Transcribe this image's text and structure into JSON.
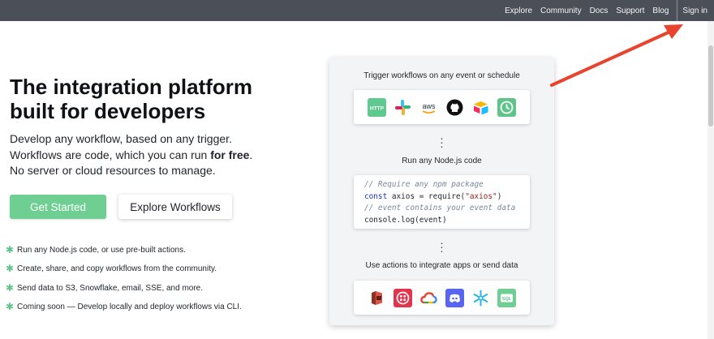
{
  "nav": {
    "links": [
      "Explore",
      "Community",
      "Docs",
      "Support",
      "Blog"
    ],
    "signin": "Sign in"
  },
  "hero": {
    "title": "The integration platform built for developers",
    "sub_line1": "Develop any workflow, based on any trigger.",
    "sub_line2_pre": "Workflows are code, which you can run ",
    "sub_line2_bold": "for free",
    "sub_line2_post": ".",
    "sub_line3": "No server or cloud resources to manage.",
    "primary_button": "Get Started",
    "secondary_button": "Explore Workflows"
  },
  "features": [
    "Run any Node.js code, or use pre-built actions.",
    "Create, share, and copy workflows from the community.",
    "Send data to S3, Snowflake, email, SSE, and more.",
    "Coming soon — Develop locally and deploy workflows via CLI."
  ],
  "panel": {
    "trigger_title": "Trigger workflows on any event or schedule",
    "trigger_icons": [
      "http-icon",
      "slack-icon",
      "aws-icon",
      "github-icon",
      "airtable-icon",
      "clock-icon"
    ],
    "http_label": "HTTP",
    "aws_label": "aws",
    "node_title": "Run any Node.js code",
    "code": {
      "line1": "// Require any npm package",
      "line2_kw": "const",
      "line2_mid": " axios = require(",
      "line2_str": "\"axios\"",
      "line2_end": ")",
      "line3": "// event contains your event data",
      "line4": "console.log(event)"
    },
    "actions_title": "Use actions to integrate apps or send data",
    "action_icons": [
      "amazon-s3-icon",
      "twilio-icon",
      "google-cloud-icon",
      "discord-icon",
      "snowflake-icon",
      "sql-icon"
    ],
    "sql_label": "SQL"
  },
  "colors": {
    "topbar": "#4a4f58",
    "primary": "#6fcf93",
    "annotation_arrow": "#e8432c"
  }
}
